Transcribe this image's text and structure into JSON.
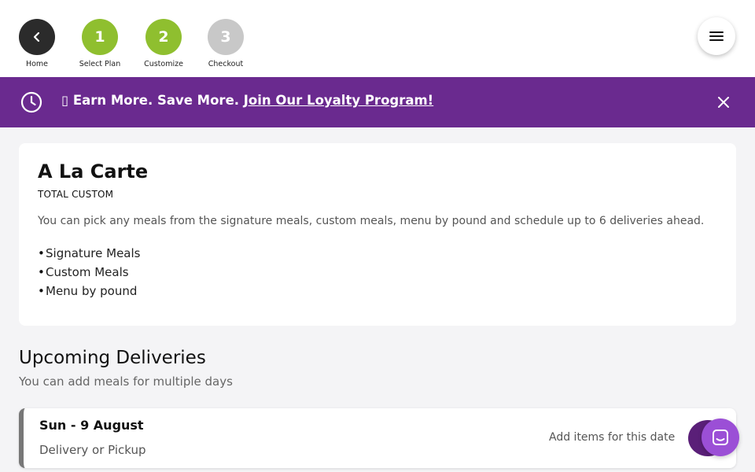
{
  "steps": [
    {
      "number": "",
      "label": "Home",
      "icon": "chevron-left-icon",
      "color": "#2b2b2b"
    },
    {
      "number": "1",
      "label": "Select Plan",
      "color": "#8fbf2f"
    },
    {
      "number": "2",
      "label": "Customize",
      "color": "#8fbf2f"
    },
    {
      "number": "3",
      "label": "Checkout",
      "color": "#c8c8c8"
    }
  ],
  "header": {
    "menu_icon": "hamburger-menu-icon"
  },
  "banner": {
    "background": "#6a2a8f",
    "glyph": "▯",
    "text": " Earn More. Save More. ",
    "link": "Join Our Loyalty Program!",
    "icon": "clock-icon",
    "close_icon": "close-icon"
  },
  "plan": {
    "title": "A La Carte",
    "subtitle": "TOTAL CUSTOM",
    "description": "You can pick any meals from the signature meals, custom meals, menu by pound and schedule up to 6 deliveries ahead.",
    "features": [
      "Signature Meals",
      "Custom Meals",
      "Menu by pound"
    ]
  },
  "upcoming": {
    "title": "Upcoming Deliveries",
    "subtitle": "You can add meals for multiple days",
    "deliveries": [
      {
        "date": "Sun - 9 August",
        "type": "Delivery or Pickup",
        "action": "Add items for this date"
      }
    ]
  },
  "chat": {
    "icon": "chat-icon",
    "color": "#9b4fd6"
  }
}
